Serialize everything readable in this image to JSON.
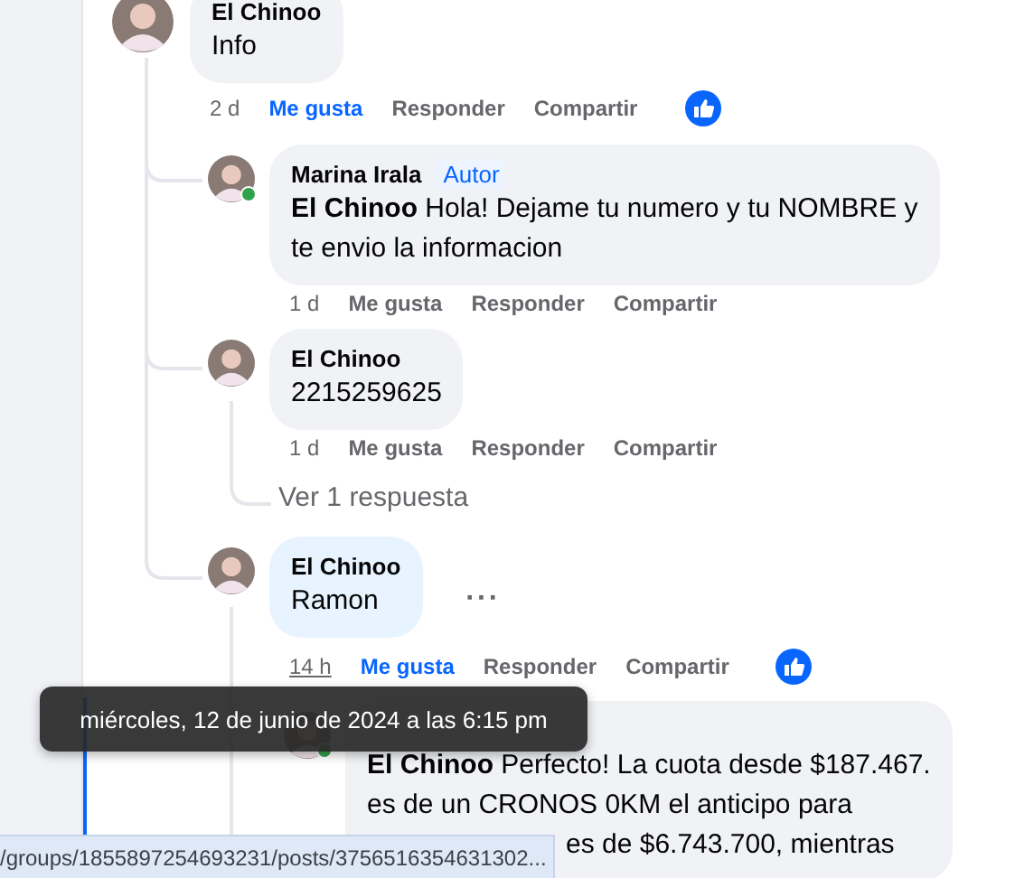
{
  "comments": [
    {
      "author": "El Chinoo",
      "text": "Info",
      "time": "2 d",
      "actions": [
        "Me gusta",
        "Responder",
        "Compartir"
      ],
      "liked": true,
      "has_reactions": true,
      "hovered": false,
      "replies": [
        {
          "author": "Marina Irala",
          "badge": "Autor",
          "lines": [
            {
              "text": "**El Chinoo** Hola! Dejame tu numero y tu NOMBRE y",
              "kind": "full"
            },
            {
              "text": "te envio la informacion",
              "kind": "full"
            }
          ],
          "time": "1 d",
          "actions": [
            "Me gusta",
            "Responder",
            "Compartir"
          ],
          "liked": false,
          "hovered": false,
          "online": true
        },
        {
          "author": "El Chinoo",
          "lines": [
            {
              "text": "2215259625",
              "kind": "full"
            }
          ],
          "time": "1 d",
          "actions": [
            "Me gusta",
            "Responder",
            "Compartir"
          ],
          "liked": false,
          "hovered": false,
          "more_replies": "Ver 1 respuesta"
        },
        {
          "author": "El Chinoo",
          "lines": [
            {
              "text": "Ramon",
              "kind": "full"
            }
          ],
          "time": "14 h",
          "actions": [
            "Me gusta",
            "Responder",
            "Compartir"
          ],
          "liked": true,
          "has_reactions": true,
          "hovered": true,
          "more_options": "···",
          "replies": [
            {
              "lines": [
                {
                  "text": "**El Chinoo** Perfecto! La cuota desde $187.467.",
                  "kind": "full"
                },
                {
                  "text": "es de un CRONOS 0KM el anticipo para",
                  "kind": "full"
                },
                {
                  "text": "es de $6.743.700, mientras",
                  "kind": "partial"
                }
              ],
              "online": true
            }
          ]
        }
      ]
    }
  ],
  "tooltip": "miércoles, 12 de junio de 2024 a las 6:15 pm",
  "status_url": "/groups/1855897254693231/posts/3756516354631302..."
}
